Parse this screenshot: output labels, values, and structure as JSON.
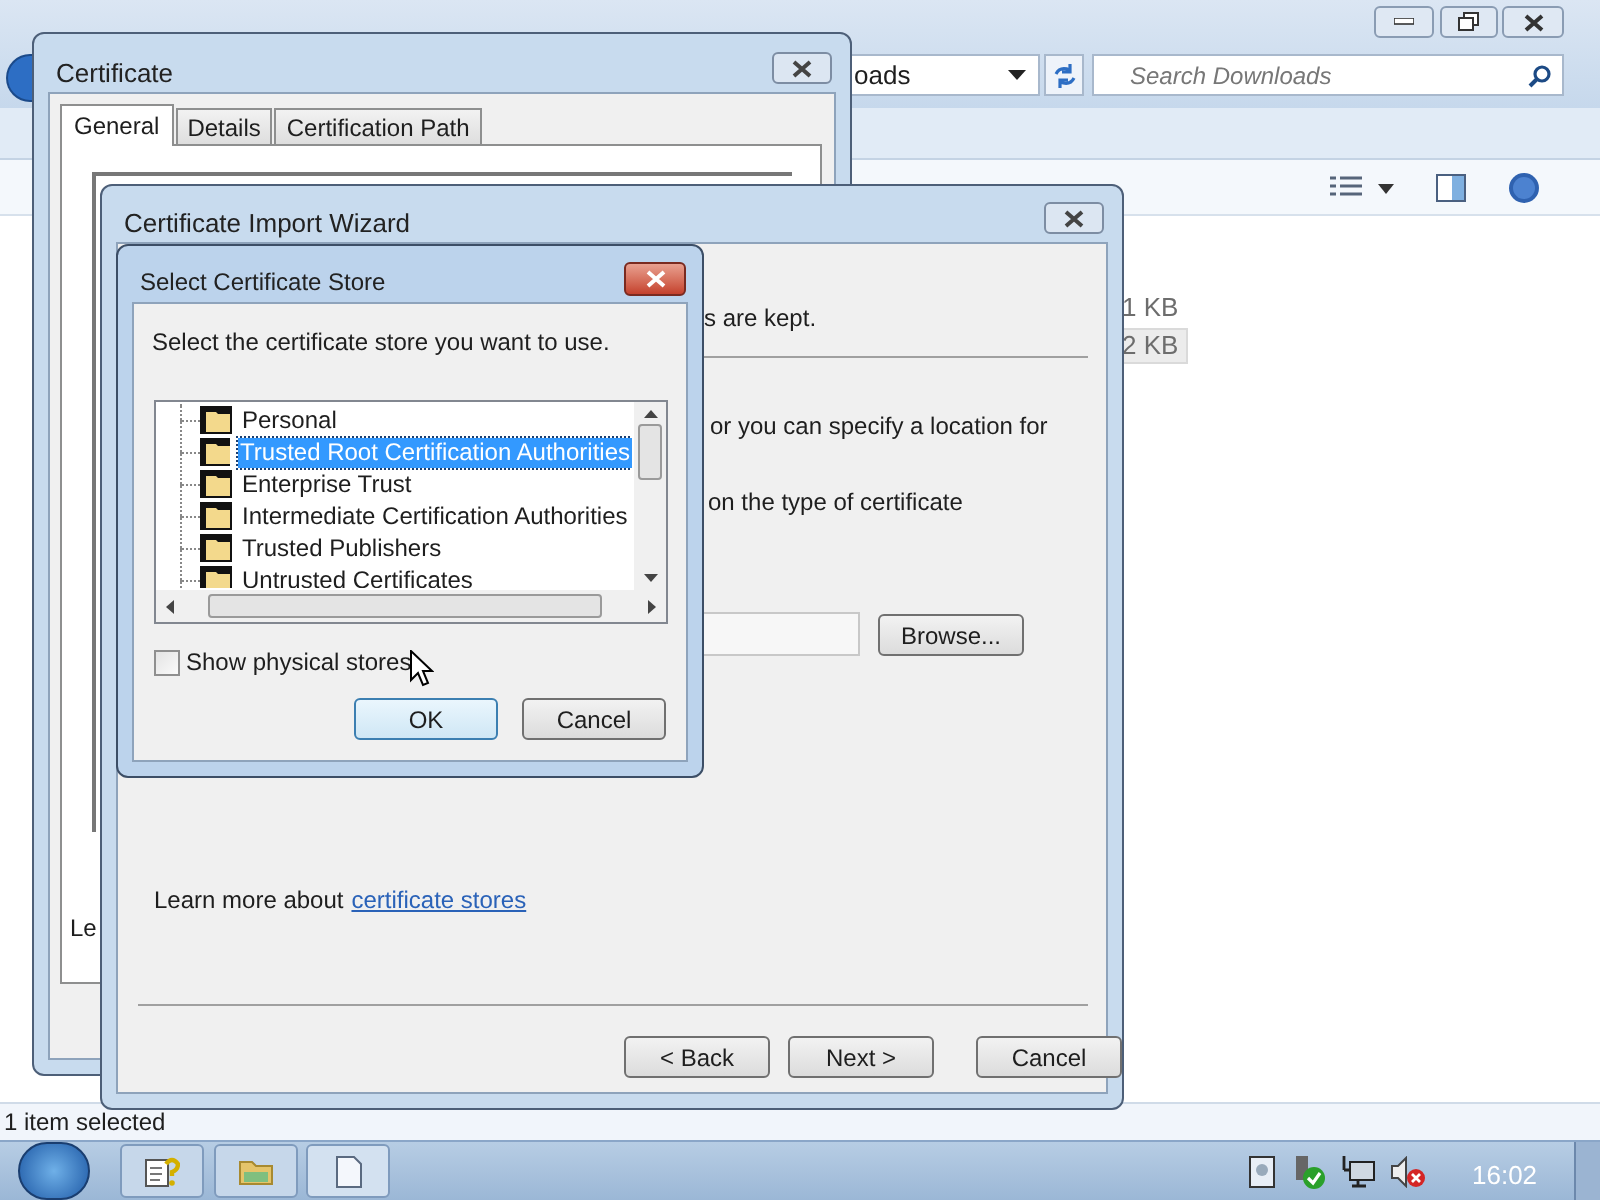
{
  "explorer": {
    "address": "oads",
    "search": {
      "placeholder": "Search Downloads"
    },
    "files": [
      {
        "size": "1 KB",
        "selected": false
      },
      {
        "size": "2 KB",
        "selected": true
      }
    ],
    "status_bar": "1 item selected"
  },
  "certificate_dialog": {
    "title": "Certificate",
    "tabs": [
      {
        "label": "General",
        "selected": true
      },
      {
        "label": "Details",
        "selected": false
      },
      {
        "label": "Certification Path",
        "selected": false
      }
    ],
    "partial_text": "Le"
  },
  "import_wizard": {
    "title": "Certificate Import Wizard",
    "texts": [
      "s are kept.",
      "or you can specify a location for",
      "on the type of certificate"
    ],
    "browse_button": "Browse...",
    "learn_more": "Learn more about",
    "learn_more_link": "certificate stores",
    "buttons": [
      "< Back",
      "Next >",
      "Cancel"
    ]
  },
  "store_dialog": {
    "title": "Select Certificate Store",
    "prompt": "Select the certificate store you want to use.",
    "stores": [
      {
        "label": "Personal",
        "selected": false
      },
      {
        "label": "Trusted Root Certification Authorities",
        "selected": true
      },
      {
        "label": "Enterprise Trust",
        "selected": false
      },
      {
        "label": "Intermediate Certification Authorities",
        "selected": false
      },
      {
        "label": "Trusted Publishers",
        "selected": false
      },
      {
        "label": "Untrusted Certificates",
        "selected": false
      }
    ],
    "show_physical_stores": {
      "label": "Show physical stores",
      "checked": false
    },
    "buttons": [
      "OK",
      "Cancel"
    ]
  },
  "taskbar": {
    "clock": "16:02"
  }
}
